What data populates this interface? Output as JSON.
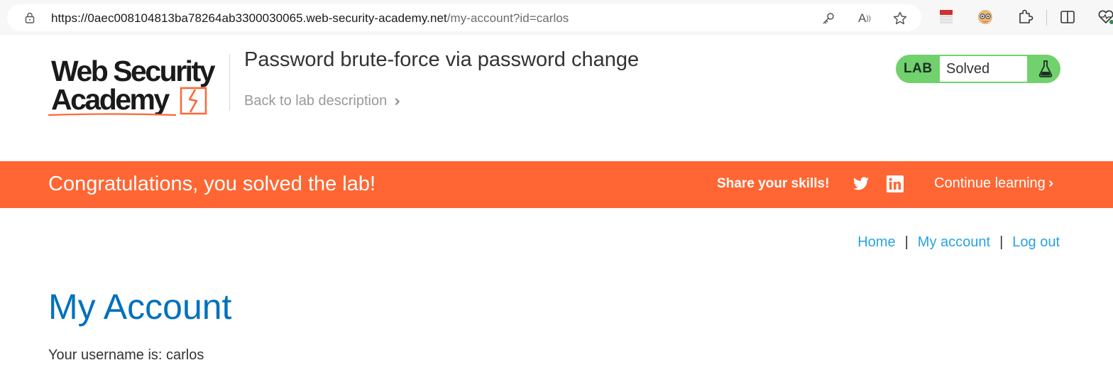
{
  "browser": {
    "url_domain": "https://0aec008104813ba78264ab3300030065.web-security-academy.net",
    "url_path": "/my-account?id=carlos",
    "icons": [
      "lock-icon",
      "key-icon",
      "read-aloud-icon",
      "favorite-star-icon",
      "extension-flag-icon",
      "extension-owl-icon",
      "extensions-puzzle-icon",
      "split-screen-icon",
      "browser-essentials-icon"
    ]
  },
  "header": {
    "logo_line1": "Web Security",
    "logo_line2": "Academy",
    "lab_title": "Password brute-force via password change",
    "back_link": "Back to lab description",
    "lab_badge": "LAB",
    "lab_status": "Solved",
    "colors": {
      "badge_green": "#70d16d",
      "accent_orange": "#ff6633"
    }
  },
  "banner": {
    "message": "Congratulations, you solved the lab!",
    "share_label": "Share your skills!",
    "continue_label": "Continue learning",
    "icons": [
      "twitter-icon",
      "linkedin-icon"
    ]
  },
  "nav": {
    "home": "Home",
    "sep1": "|",
    "my_account": "My account",
    "sep2": "|",
    "log_out": "Log out"
  },
  "content": {
    "heading": "My Account",
    "username_line": "Your username is: carlos"
  }
}
